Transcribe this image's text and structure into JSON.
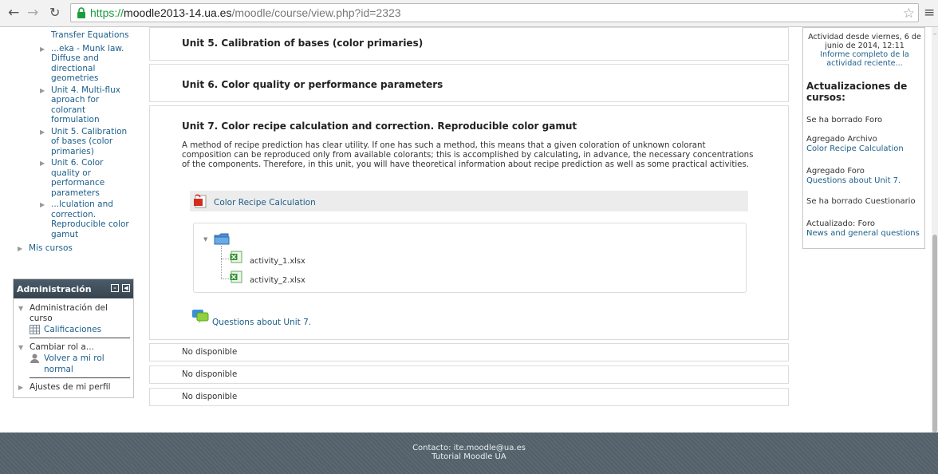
{
  "browser": {
    "url_scheme": "https://",
    "url_host": "moodle2013-14.ua.es",
    "url_path": "/moodle/course/view.php?id=2323"
  },
  "nav_tree": {
    "items": [
      {
        "label": "Transfer Equations"
      },
      {
        "label": "...eka - Munk law. Diffuse and directional geometries"
      },
      {
        "label": "Unit 4. Multi-flux aproach for colorant formulation"
      },
      {
        "label": "Unit 5. Calibration of bases (color primaries)"
      },
      {
        "label": "Unit 6. Color quality or performance parameters"
      },
      {
        "label": "...lculation and correction. Reproducible color gamut"
      }
    ],
    "mis_cursos": "Mis cursos"
  },
  "admin": {
    "title": "Administración",
    "course_admin": "Administración del curso",
    "grades": "Calificaciones",
    "switch_role": "Cambiar rol a...",
    "normal_role": "Volver a mi rol normal",
    "profile_settings": "Ajustes de mi perfil"
  },
  "sections": {
    "unit5_title": "Unit 5. Calibration of bases (color primaries)",
    "unit6_title": "Unit 6. Color quality or performance parameters",
    "unit7_title": "Unit 7. Color recipe calculation and correction. Reproducible color gamut",
    "unit7_summary": "A method of recipe prediction has clear utility. If one has such a method, this means that a given coloration of unknown colorant composition can be reproduced only from available colorants; this is accomplished by calculating, in advance, the necessary concentrations of the components. Therefore, in this unit, you will have theoretical information about recipe prediction as well as some practical activities.",
    "resource_label": "Color Recipe Calculation",
    "files": [
      "activity_1.xlsx",
      "activity_2.xlsx"
    ],
    "forum_label": "Questions about Unit 7.",
    "not_available": [
      "No disponible",
      "No disponible",
      "No disponible"
    ]
  },
  "recent_activity": {
    "since": "Actividad desde viernes, 6 de junio de 2014, 12:11",
    "full_report": "Informe completo de la actividad reciente...",
    "updates_title": "Actualizaciones de cursos:",
    "updates": [
      {
        "action": "Se ha borrado Foro",
        "link": ""
      },
      {
        "action": "Agregado Archivo",
        "link": "Color Recipe Calculation"
      },
      {
        "action": "Agregado Foro",
        "link": "Questions about Unit 7."
      },
      {
        "action": "Se ha borrado Cuestionario",
        "link": ""
      },
      {
        "action": "Actualizado: Foro",
        "link": "News and general questions"
      }
    ]
  },
  "footer": {
    "contact": "Contacto: ite.moodle@ua.es",
    "tutorial": "Tutorial Moodle UA"
  },
  "colors": {
    "link": "#1b5e8a",
    "admin_header": "#3f4e5a",
    "footer": "#56636c",
    "secure_green": "#1a9c3e"
  }
}
